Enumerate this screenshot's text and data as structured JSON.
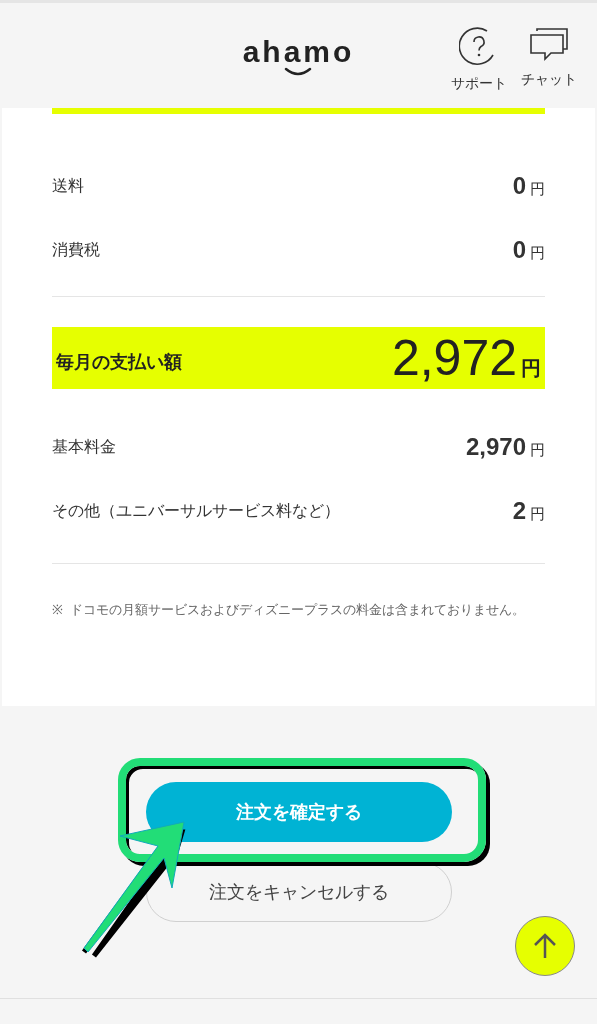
{
  "header": {
    "logo": "ahamo",
    "actions": [
      {
        "label": "サポート",
        "kind": "help"
      },
      {
        "label": "チャット",
        "kind": "chat"
      }
    ]
  },
  "fees": [
    {
      "label": "送料",
      "amount": "0",
      "unit": "円"
    },
    {
      "label": "消費税",
      "amount": "0",
      "unit": "円"
    }
  ],
  "total": {
    "label": "毎月の支払い額",
    "amount": "2,972",
    "unit": "円"
  },
  "breakdown": [
    {
      "label": "基本料金",
      "amount": "2,970",
      "unit": "円"
    },
    {
      "label": "その他（ユニバーサルサービス料など）",
      "amount": "2",
      "unit": "円"
    }
  ],
  "note": {
    "mark": "※",
    "text": "ドコモの月額サービスおよびディズニープラスの料金は含まれておりません。"
  },
  "buttons": [
    {
      "label": "注文を確定する",
      "kind": "primary"
    },
    {
      "label": "注文をキャンセルする",
      "kind": "secondary"
    }
  ]
}
